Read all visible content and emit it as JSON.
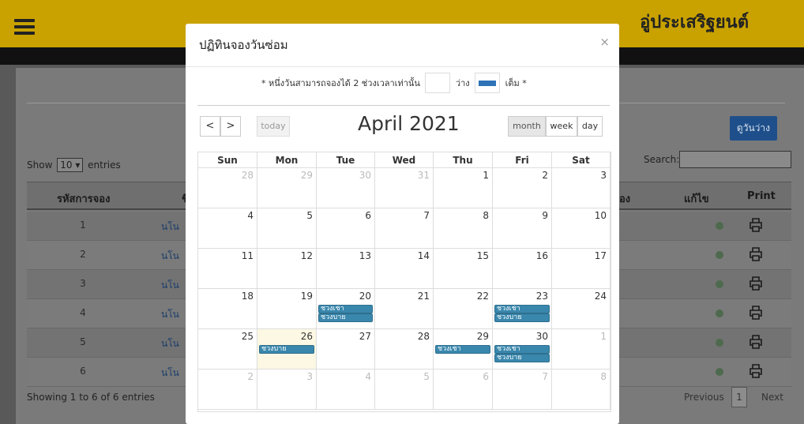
{
  "header": {
    "brand": "อู่ประเสริฐยนต์"
  },
  "backdrop": {
    "free_button": "ดูวันว่าง",
    "show_label_before": "Show",
    "show_value": "10",
    "show_label_after": "entries",
    "search_label": "Search:",
    "columns": [
      "รหัสการจอง",
      "ชื่",
      "อง",
      "แก้ไข",
      "Print"
    ],
    "rows": [
      {
        "id": "1",
        "name": "นโน"
      },
      {
        "id": "2",
        "name": "นโน"
      },
      {
        "id": "3",
        "name": "นโน"
      },
      {
        "id": "4",
        "name": "นโน"
      },
      {
        "id": "5",
        "name": "นโน"
      },
      {
        "id": "6",
        "name": "นโน"
      }
    ],
    "footer_info": "Showing 1 to 6 of 6 entries",
    "prev_label": "Previous",
    "current_page": "1",
    "next_label": "Next"
  },
  "modal": {
    "title": "ปฏิทินจองวันซ่อม",
    "close": "×",
    "legend_text": "* หนึ่งวันสามารถจองได้ 2 ช่วงเวลาเท่านั้น",
    "legend_free": "ว่าง",
    "legend_full": "เต็ม *",
    "legend_full_color": "#2e73b8",
    "prev": "<",
    "next": ">",
    "today": "today",
    "month_title": "April 2021",
    "views": [
      "month",
      "week",
      "day"
    ],
    "active_view": "month",
    "event_color": "#3a87ad",
    "highlight_color": "#fcf8e3",
    "weekdays": [
      "Sun",
      "Mon",
      "Tue",
      "Wed",
      "Thu",
      "Fri",
      "Sat"
    ],
    "weeks": [
      [
        {
          "d": "28",
          "o": true
        },
        {
          "d": "29",
          "o": true
        },
        {
          "d": "30",
          "o": true
        },
        {
          "d": "31",
          "o": true
        },
        {
          "d": "1"
        },
        {
          "d": "2"
        },
        {
          "d": "3"
        }
      ],
      [
        {
          "d": "4"
        },
        {
          "d": "5"
        },
        {
          "d": "6"
        },
        {
          "d": "7"
        },
        {
          "d": "8"
        },
        {
          "d": "9"
        },
        {
          "d": "10"
        }
      ],
      [
        {
          "d": "11"
        },
        {
          "d": "12"
        },
        {
          "d": "13"
        },
        {
          "d": "14"
        },
        {
          "d": "15"
        },
        {
          "d": "16"
        },
        {
          "d": "17"
        }
      ],
      [
        {
          "d": "18"
        },
        {
          "d": "19"
        },
        {
          "d": "20",
          "ev": [
            "ช่วงเช้า",
            "ช่วงบ่าย"
          ]
        },
        {
          "d": "21"
        },
        {
          "d": "22"
        },
        {
          "d": "23",
          "ev": [
            "ช่วงเช้า",
            "ช่วงบ่าย"
          ]
        },
        {
          "d": "24"
        }
      ],
      [
        {
          "d": "25"
        },
        {
          "d": "26",
          "hl": true,
          "ev": [
            "ช่วงบ่าย"
          ]
        },
        {
          "d": "27"
        },
        {
          "d": "28"
        },
        {
          "d": "29",
          "ev": [
            "ช่วงเช้า"
          ]
        },
        {
          "d": "30",
          "ev": [
            "ช่วงเช้า",
            "ช่วงบ่าย"
          ]
        },
        {
          "d": "1",
          "o": true
        }
      ],
      [
        {
          "d": "2",
          "o": true
        },
        {
          "d": "3",
          "o": true
        },
        {
          "d": "4",
          "o": true
        },
        {
          "d": "5",
          "o": true
        },
        {
          "d": "6",
          "o": true
        },
        {
          "d": "7",
          "o": true
        },
        {
          "d": "8",
          "o": true
        }
      ]
    ]
  }
}
